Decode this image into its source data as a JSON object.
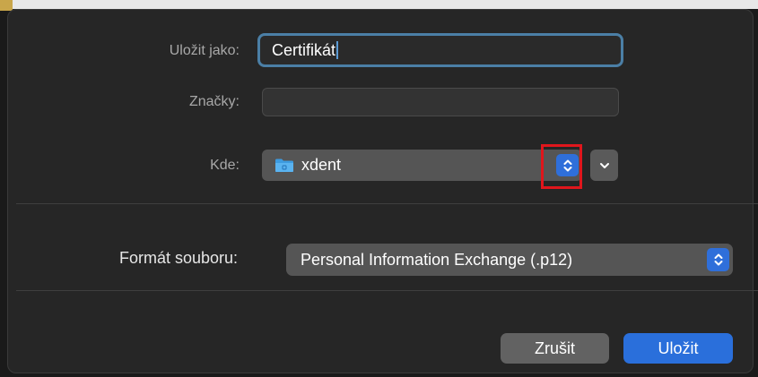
{
  "dialog": {
    "save_as_label": "Uložit jako:",
    "file_name_value": "Certifikát",
    "tags_label": "Značky:",
    "tags_value": "",
    "where_label": "Kde:",
    "where_value": "xdent",
    "format_label": "Formát souboru:",
    "format_value": "Personal Information Exchange (.p12)",
    "cancel_label": "Zrušit",
    "save_label": "Uložit"
  },
  "icons": {
    "folder": "folder-icon",
    "where_stepper": "chevron-up-down-icon",
    "expand": "chevron-down-icon",
    "format_stepper": "chevron-up-down-icon"
  },
  "colors": {
    "accent": "#2a6fdb",
    "focus_ring": "#4b7fa6",
    "highlight": "#e0161c",
    "dialog_bg": "#262626"
  }
}
